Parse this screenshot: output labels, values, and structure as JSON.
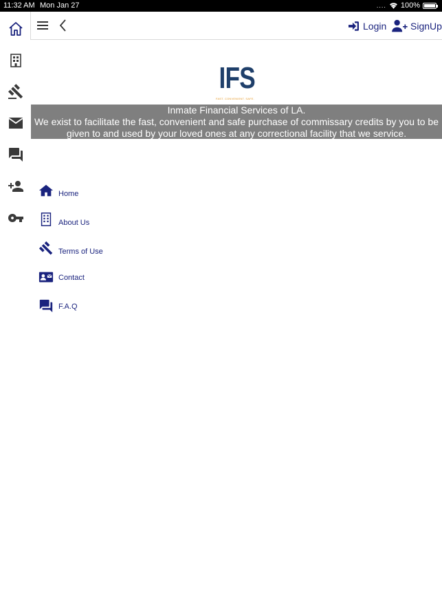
{
  "status": {
    "time": "11:32 AM",
    "date": "Mon Jan 27",
    "battery": "100%"
  },
  "rail": {
    "items": [
      {
        "name": "home",
        "icon": "home-outline-icon"
      },
      {
        "name": "about",
        "icon": "building-icon"
      },
      {
        "name": "terms",
        "icon": "gavel-icon"
      },
      {
        "name": "contact",
        "icon": "mail-icon"
      },
      {
        "name": "faq",
        "icon": "forum-icon"
      },
      {
        "name": "signup",
        "icon": "person-add-icon"
      },
      {
        "name": "login",
        "icon": "key-icon"
      }
    ]
  },
  "topbar": {
    "login_label": "Login",
    "signup_label": "SignUp"
  },
  "logo": {
    "text": "IFS",
    "tagline": "FAST. CONVENIENT. SAFE."
  },
  "banner": {
    "line1": "Inmate Financial Services of LA.",
    "line2": "We exist to facilitate the fast, convenient and safe purchase of commissary credits by you to be",
    "line3": "given to and used by your loved ones at any correctional facility that we service."
  },
  "menu": {
    "items": [
      {
        "label": "Home",
        "icon": "home-icon"
      },
      {
        "label": "About Us",
        "icon": "building-icon"
      },
      {
        "label": "Terms of Use",
        "icon": "gavel-icon"
      },
      {
        "label": "Contact",
        "icon": "contact-card-icon"
      },
      {
        "label": "F.A.Q",
        "icon": "forum-icon"
      }
    ]
  },
  "colors": {
    "accent": "#1a237e",
    "rail_icon": "#3a3a3a",
    "banner_bg": "#7f7f7f",
    "logo_blue": "#1f3f6a",
    "logo_orange": "#e59a2b"
  }
}
